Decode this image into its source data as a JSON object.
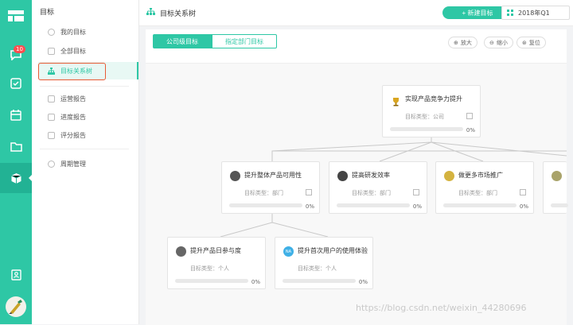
{
  "rail": {
    "badge": "10"
  },
  "sidebar": {
    "title": "目标",
    "items": [
      {
        "label": "我的目标"
      },
      {
        "label": "全部目标"
      },
      {
        "label": "目标关系树"
      },
      {
        "label": "运营报告"
      },
      {
        "label": "进度报告"
      },
      {
        "label": "评分报告"
      },
      {
        "label": "周期管理"
      }
    ]
  },
  "topbar": {
    "title": "目标关系树",
    "new_button": "+ 新建目标",
    "period": "2018年Q1"
  },
  "tabs": [
    {
      "label": "公司级目标"
    },
    {
      "label": "指定部门目标"
    }
  ],
  "tools": {
    "zoom_in": "放大",
    "zoom_out": "缩小",
    "reset": "复位"
  },
  "cards": [
    {
      "name": "实现产品竞争力提升",
      "meta": "目标类型：公司",
      "progress": "0%"
    },
    {
      "name": "提升整体产品可用性",
      "meta": "目标类型：部门",
      "progress": "0%"
    },
    {
      "name": "提高研发效率",
      "meta": "目标类型：部门",
      "progress": "0%"
    },
    {
      "name": "做更多市场推广",
      "meta": "目标类型：部门",
      "progress": "0%"
    },
    {
      "name": "提升产品日参与度",
      "meta": "目标类型：个人",
      "progress": "0%"
    },
    {
      "name": "提升首次用户的使用体验",
      "meta": "目标类型：个人",
      "progress": "0%",
      "avatar_text": "NA"
    }
  ],
  "watermark": "https://blog.csdn.net/weixin_44280696",
  "colors": {
    "accent": "#2ec7a5",
    "highlight": "#e85a35",
    "badge": "#ff4d4f"
  }
}
